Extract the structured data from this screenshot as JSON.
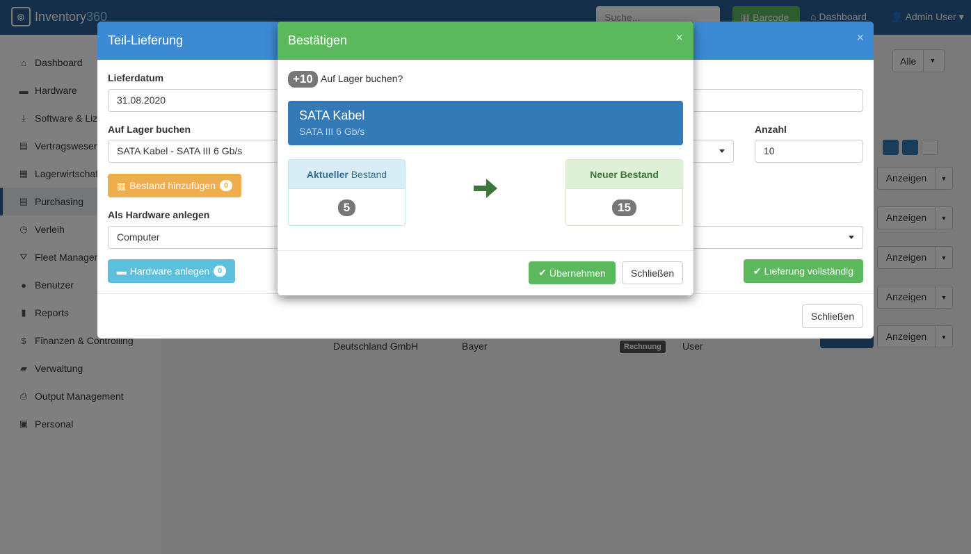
{
  "app": {
    "brand_main": "Inventory",
    "brand_suffix": "360",
    "search_placeholder": "Suche...",
    "barcode_label": "Barcode",
    "dashboard_link": "Dashboard",
    "user_link": "Admin User"
  },
  "sidebar": {
    "items": [
      {
        "label": "Dashboard",
        "icon": "home-icon"
      },
      {
        "label": "Hardware",
        "icon": "hdd-icon"
      },
      {
        "label": "Software & Lizenzen",
        "icon": "download-icon"
      },
      {
        "label": "Vertragswesen",
        "icon": "file-icon"
      },
      {
        "label": "Lagerwirtschaft",
        "icon": "th-icon"
      },
      {
        "label": "Purchasing",
        "icon": "list-alt-icon"
      },
      {
        "label": "Verleih",
        "icon": "clock-icon"
      },
      {
        "label": "Fleet Management",
        "icon": "road-icon"
      },
      {
        "label": "Benutzer",
        "icon": "user-icon"
      },
      {
        "label": "Reports",
        "icon": "stats-icon"
      },
      {
        "label": "Finanzen & Controlling",
        "icon": "dollar-icon"
      },
      {
        "label": "Verwaltung",
        "icon": "folder-icon"
      },
      {
        "label": "Output Management",
        "icon": "print-icon"
      },
      {
        "label": "Personal",
        "icon": "briefcase-icon"
      }
    ]
  },
  "background": {
    "filter_label": "Alle",
    "row_action_label": "Anzeigen",
    "row_text_1": "Deutschland GmbH",
    "row_text_2": "Bayer",
    "row_badge": "Rechnung",
    "row_text_3": "User"
  },
  "teil_lieferung": {
    "title": "Teil-Lieferung",
    "lieferdatum_label": "Lieferdatum",
    "lieferdatum_value": "31.08.2020",
    "auf_lager_label": "Auf Lager buchen",
    "auf_lager_value": "SATA Kabel - SATA III 6 Gb/s",
    "anzahl_label": "Anzahl",
    "anzahl_value": "10",
    "bestand_button": "Bestand hinzufügen",
    "bestand_count": "0",
    "als_hardware_label": "Als Hardware anlegen",
    "als_hardware_value": "Computer",
    "hardware_button": "Hardware anlegen",
    "hardware_count": "0",
    "lieferung_button": "Lieferung vollständig",
    "close_button": "Schließen"
  },
  "bestaetigen": {
    "title": "Bestätigen",
    "quantity": "+10",
    "question": "Auf Lager buchen?",
    "product_name": "SATA Kabel",
    "product_sub": "SATA III 6 Gb/s",
    "current_label_bold": "Aktueller",
    "current_label_rest": " Bestand",
    "current_value": "5",
    "new_label": "Neuer Bestand",
    "new_value": "15",
    "confirm_button": "Übernehmen",
    "close_button": "Schließen"
  },
  "colors": {
    "primary": "#337ab7",
    "success": "#5cb85c",
    "warning": "#f0ad4e",
    "info": "#5bc0de",
    "arrow": "#3c763d"
  }
}
